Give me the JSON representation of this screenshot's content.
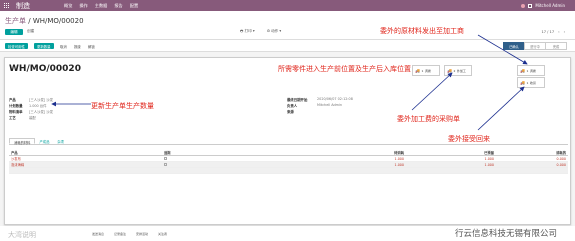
{
  "topbar": {
    "app": "制造",
    "menu": [
      "概览",
      "操作",
      "主数据",
      "报告",
      "配置"
    ],
    "user": "Mitchell Admin"
  },
  "breadcrumb": {
    "parent": "生产单",
    "sep": " / ",
    "current": "WH/MO/00020"
  },
  "buttons": {
    "edit": "编辑",
    "create": "创建",
    "print": "打印",
    "action": "动作"
  },
  "pager": {
    "text": "17 / 17"
  },
  "status_buttons": [
    {
      "label": "检查可用性",
      "style": "primary"
    },
    {
      "label": "更新数量",
      "style": "primary"
    },
    {
      "label": "取消",
      "style": "plain"
    },
    {
      "label": "报废",
      "style": "plain"
    },
    {
      "label": "解锁",
      "style": "plain"
    }
  ],
  "steps": [
    {
      "label": "已确认",
      "active": true
    },
    {
      "label": "进行中",
      "active": false
    },
    {
      "label": "完成",
      "active": false
    }
  ],
  "record": {
    "title": "WH/MO/00020"
  },
  "smart_buttons": [
    {
      "count": "1",
      "label": "调拨",
      "icon": "truck-icon"
    },
    {
      "count": "2",
      "label": "外加工",
      "icon": "truck-icon"
    },
    {
      "count": "1",
      "label": "调拨",
      "icon": "truck-icon"
    },
    {
      "count": "1",
      "label": "收货",
      "icon": "truck-icon"
    }
  ],
  "fields_left": [
    {
      "label": "产品",
      "value": "[三人沙发] 沙发"
    },
    {
      "label": "计划数量",
      "value": "1.000 台件"
    },
    {
      "label": "物料清单",
      "value": "[三人沙发] 沙发"
    },
    {
      "label": "工艺",
      "value": "装配"
    }
  ],
  "fields_right": [
    {
      "label": "最终日期开始",
      "value": "2020/06/07 02:12:08"
    },
    {
      "label": "负责人",
      "value": "Mitchell Admin"
    },
    {
      "label": "来源",
      "value": ""
    }
  ],
  "tabs": [
    "消耗的材料",
    "产成品",
    "杂项"
  ],
  "table": {
    "headers": [
      "产品",
      "追踪",
      "待消耗",
      "已预留",
      "消耗的"
    ],
    "rows": [
      {
        "product": "沙发布",
        "reserved": "1.000",
        "done": "1.000",
        "consumed": "0.000"
      },
      {
        "product": "泡沫海绵",
        "reserved": "1.000",
        "done": "1.000",
        "consumed": "0.000"
      }
    ]
  },
  "annotations": {
    "a1": "委外的原材料发出至加工商",
    "a2": "所需零件进入生产前位置及生产后入库位置",
    "a3": "更新生产单生产数量",
    "a4": "委外加工费的采购单",
    "a5": "委外接受回来"
  },
  "footer": {
    "watermark_left": "大湾说明",
    "watermark_right": "行云信息科技无锡有限公司",
    "actions": [
      "发送消息",
      "记录备注",
      "安排活动",
      "关注者"
    ]
  },
  "colors": {
    "brand": "#875a7b",
    "primary_button": "#00a09d",
    "annotation": "#e0251b",
    "active_step": "#2f5f8a"
  }
}
